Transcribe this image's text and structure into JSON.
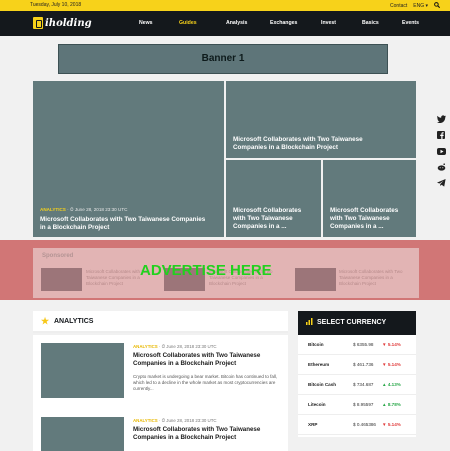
{
  "topbar": {
    "date": "Tuesday, July 10, 2018",
    "contact": "Contact",
    "lang": "ENG",
    "lang_caret": "▾",
    "search_icon": "search-icon"
  },
  "nav": {
    "logo": "iholding",
    "items": [
      {
        "label": "News",
        "active": false
      },
      {
        "label": "Guides",
        "active": true
      },
      {
        "label": "Analysis",
        "active": false
      },
      {
        "label": "Exchanges",
        "active": false
      },
      {
        "label": "Invest",
        "active": false
      },
      {
        "label": "Basics",
        "active": false
      },
      {
        "label": "Events",
        "active": false
      }
    ]
  },
  "banner": {
    "label": "Banner 1"
  },
  "featured": {
    "main": {
      "category": "ANALYTICS",
      "date": "June 28, 2018 23:30 UTC",
      "title": "Microsoft Collaborates with Two Taiwanese Companies in a Blockchain Project"
    },
    "top_right": {
      "title": "Microsoft Collaborates with Two Taiwanese Companies in a Blockchain Project"
    },
    "bottom_left": {
      "title": "Microsoft Collaborates with Two Taiwanese Companies in a ..."
    },
    "bottom_right": {
      "title": "Microsoft Collaborates with Two Taiwanese Companies in a ..."
    }
  },
  "social": [
    "twitter-icon",
    "facebook-icon",
    "youtube-icon",
    "reddit-icon",
    "telegram-icon"
  ],
  "sponsored": {
    "label": "Sponsored",
    "overlay": "ADVERTISE HERE",
    "items": [
      {
        "title": "Microsoft Collaborates with Two Taiwanese Companies in a Blockchain Project"
      },
      {
        "title": "Microsoft Collaborates with Two Taiwanese Companies in a Blockchain Project"
      },
      {
        "title": "Microsoft Collaborates with Two Taiwanese Companies in a Blockchain Project"
      }
    ]
  },
  "analytics": {
    "heading": "ANALYTICS",
    "articles": [
      {
        "category": "ANALYTICS",
        "date": "June 28, 2018 23:30 UTC",
        "title": "Microsoft Collaborates with Two Taiwanese Companies in a Blockchain Project",
        "excerpt": "Crypto market is undergoing a bear market. Bitcoin has continued to fall, which led to a decline in the whole market as most cryptocurrencies are currently..."
      },
      {
        "category": "ANALYTICS",
        "date": "June 28, 2018 23:30 UTC",
        "title": "Microsoft Collaborates with Two Taiwanese Companies in a Blockchain Project",
        "excerpt": ""
      }
    ]
  },
  "currency": {
    "heading": "SELECT CURRENCY",
    "rows": [
      {
        "name": "Bitcoin",
        "price": "$ 6355.98",
        "change": "5.14%",
        "dir": "down"
      },
      {
        "name": "Ethereum",
        "price": "$ 461.736",
        "change": "5.14%",
        "dir": "down"
      },
      {
        "name": "Bitcoin Cash",
        "price": "$ 734.687",
        "change": "4.13%",
        "dir": "up"
      },
      {
        "name": "Litecoin",
        "price": "$ 8.95597",
        "change": "8.78%",
        "dir": "up"
      },
      {
        "name": "XRP",
        "price": "$ 0.465386",
        "change": "5.14%",
        "dir": "down"
      }
    ],
    "colors": {
      "up": "#2aa84a",
      "down": "#e03b3b"
    }
  }
}
